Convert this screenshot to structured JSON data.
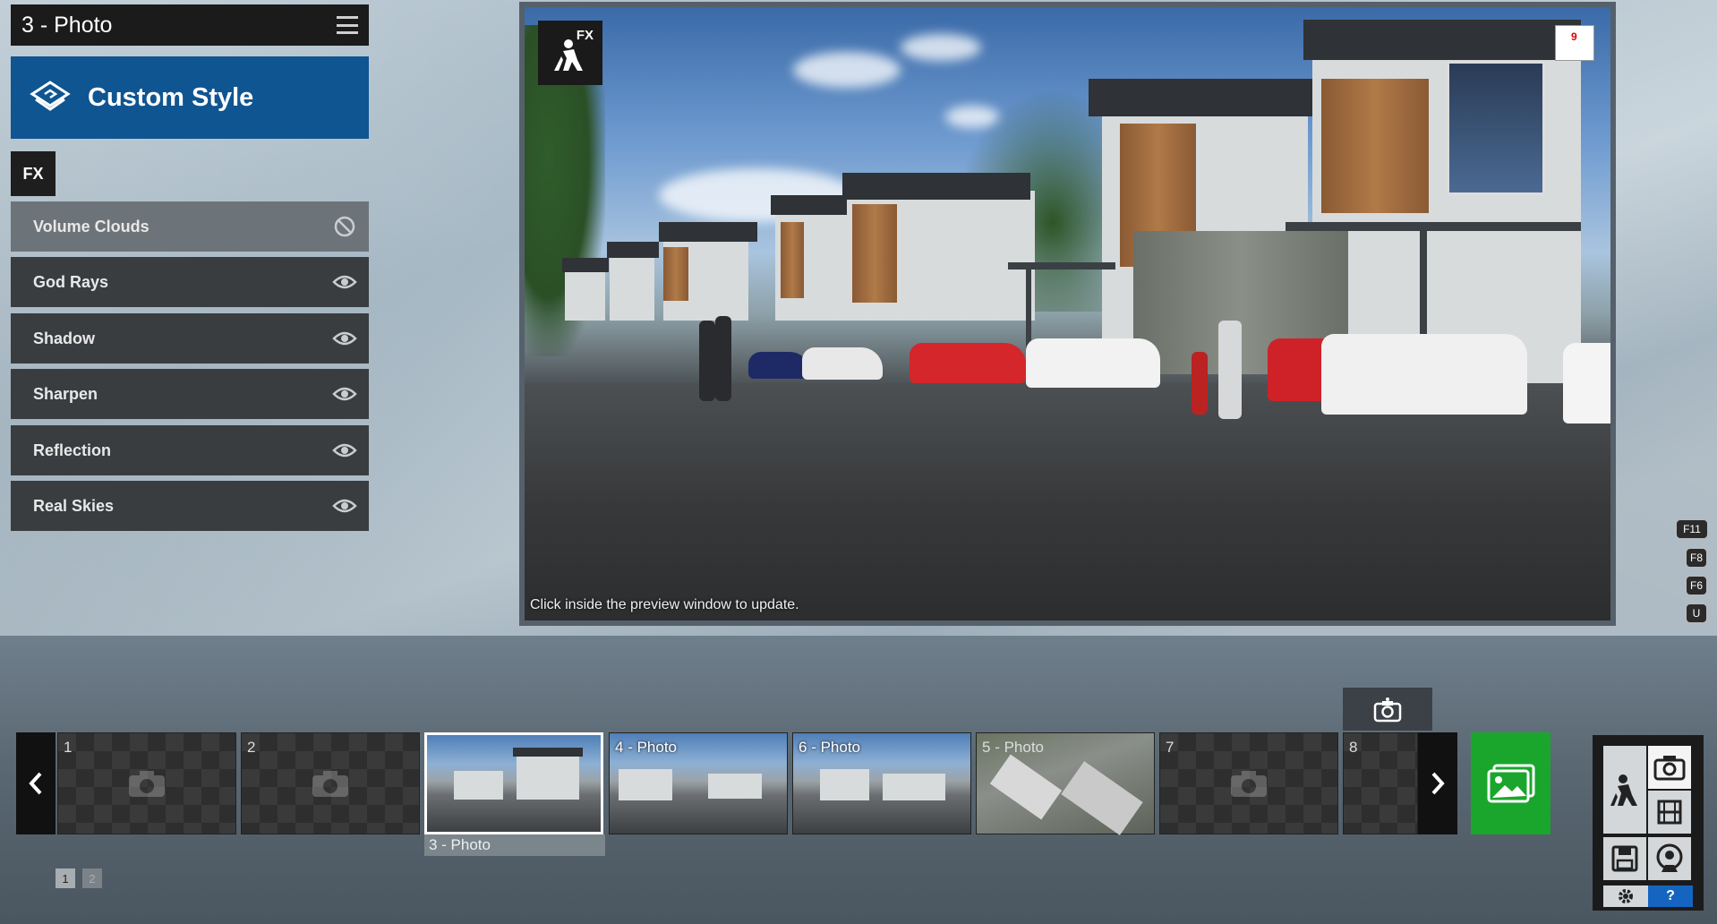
{
  "header": {
    "title": "3 - Photo"
  },
  "style_button": {
    "label": "Custom Style"
  },
  "fx_tab": {
    "label": "FX"
  },
  "effects": [
    {
      "label": "Volume Clouds",
      "state": "disabled"
    },
    {
      "label": "God Rays",
      "state": "visible"
    },
    {
      "label": "Shadow",
      "state": "visible"
    },
    {
      "label": "Sharpen",
      "state": "visible"
    },
    {
      "label": "Reflection",
      "state": "visible"
    },
    {
      "label": "Real Skies",
      "state": "visible"
    }
  ],
  "preview": {
    "fx_label": "FX",
    "badge": "9",
    "hint": "Click inside the preview window to update."
  },
  "keys": [
    "F11",
    "F8",
    "F6",
    "U"
  ],
  "thumbnails": [
    {
      "num": "1",
      "label": ""
    },
    {
      "num": "2",
      "label": ""
    },
    {
      "num": "",
      "label": "3 - Photo"
    },
    {
      "num": "4",
      "label": "- Photo"
    },
    {
      "num": "6",
      "label": "- Photo"
    },
    {
      "num": "5",
      "label": "- Photo"
    },
    {
      "num": "7",
      "label": ""
    },
    {
      "num": "8",
      "label": ""
    }
  ],
  "selected_caption": "3 - Photo",
  "pages": [
    "1",
    "2"
  ],
  "help_label": "?",
  "colors": {
    "accent_blue": "#0f5591",
    "export_green": "#1aa62c",
    "help_blue": "#1565c0"
  }
}
